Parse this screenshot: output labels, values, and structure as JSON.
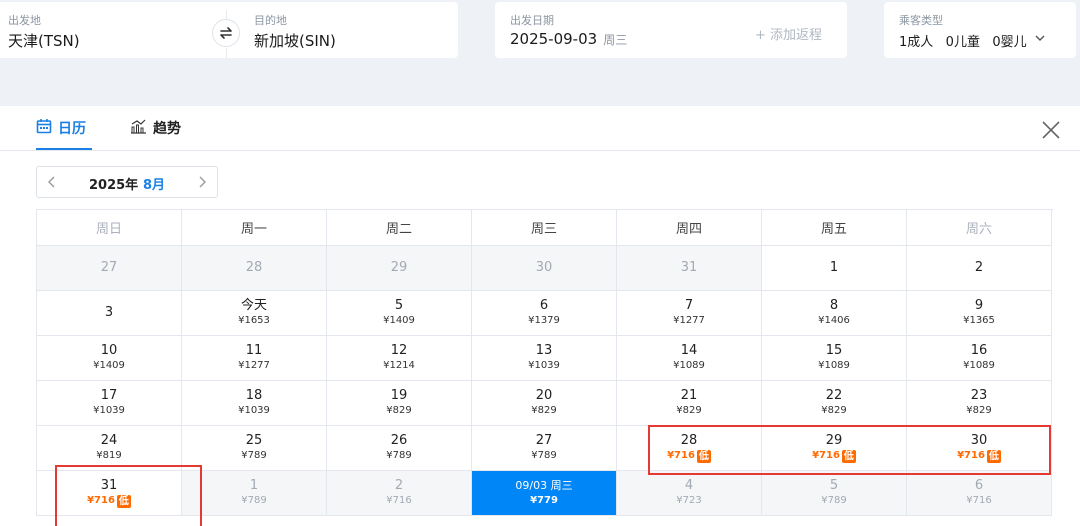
{
  "search": {
    "from_label": "出发地",
    "from_value": "天津(TSN)",
    "to_label": "目的地",
    "to_value": "新加坡(SIN)",
    "date_label": "出发日期",
    "date_value": "2025-09-03",
    "date_weekday": "周三",
    "add_return": "+ 添加返程",
    "pax_label": "乘客类型",
    "pax_value": "1成人   0儿童   0婴儿"
  },
  "tabs": [
    {
      "label": "日历",
      "icon": "calendar-icon",
      "active": true
    },
    {
      "label": "趋势",
      "icon": "trend-chart-icon",
      "active": false
    }
  ],
  "month_nav": {
    "year": "2025年",
    "month": "8月"
  },
  "weekdays": [
    "周日",
    "周一",
    "周二",
    "周三",
    "周四",
    "周五",
    "周六"
  ],
  "calendar": [
    [
      {
        "day": "27",
        "price": "",
        "dim": true
      },
      {
        "day": "28",
        "price": "",
        "dim": true
      },
      {
        "day": "29",
        "price": "",
        "dim": true
      },
      {
        "day": "30",
        "price": "",
        "dim": true
      },
      {
        "day": "31",
        "price": "",
        "dim": true
      },
      {
        "day": "1",
        "price": ""
      },
      {
        "day": "2",
        "price": ""
      }
    ],
    [
      {
        "day": "3",
        "price": ""
      },
      {
        "day": "今天",
        "price": "¥1653"
      },
      {
        "day": "5",
        "price": "¥1409"
      },
      {
        "day": "6",
        "price": "¥1379"
      },
      {
        "day": "7",
        "price": "¥1277"
      },
      {
        "day": "8",
        "price": "¥1406"
      },
      {
        "day": "9",
        "price": "¥1365"
      }
    ],
    [
      {
        "day": "10",
        "price": "¥1409"
      },
      {
        "day": "11",
        "price": "¥1277"
      },
      {
        "day": "12",
        "price": "¥1214"
      },
      {
        "day": "13",
        "price": "¥1039"
      },
      {
        "day": "14",
        "price": "¥1089"
      },
      {
        "day": "15",
        "price": "¥1089"
      },
      {
        "day": "16",
        "price": "¥1089"
      }
    ],
    [
      {
        "day": "17",
        "price": "¥1039"
      },
      {
        "day": "18",
        "price": "¥1039"
      },
      {
        "day": "19",
        "price": "¥829"
      },
      {
        "day": "20",
        "price": "¥829"
      },
      {
        "day": "21",
        "price": "¥829"
      },
      {
        "day": "22",
        "price": "¥829"
      },
      {
        "day": "23",
        "price": "¥829"
      }
    ],
    [
      {
        "day": "24",
        "price": "¥819"
      },
      {
        "day": "25",
        "price": "¥789"
      },
      {
        "day": "26",
        "price": "¥789"
      },
      {
        "day": "27",
        "price": "¥789"
      },
      {
        "day": "28",
        "price": "¥716",
        "low": true
      },
      {
        "day": "29",
        "price": "¥716",
        "low": true
      },
      {
        "day": "30",
        "price": "¥716",
        "low": true
      }
    ],
    [
      {
        "day": "31",
        "price": "¥716",
        "low": true
      },
      {
        "day": "1",
        "price": "¥789",
        "dim": true
      },
      {
        "day": "2",
        "price": "¥716",
        "dim": true
      },
      {
        "day": "09/03 周三",
        "price": "¥779",
        "selected": true
      },
      {
        "day": "4",
        "price": "¥723",
        "dim": true
      },
      {
        "day": "5",
        "price": "¥789",
        "dim": true
      },
      {
        "day": "6",
        "price": "¥716",
        "dim": true
      }
    ]
  ],
  "low_badge": "低",
  "colors": {
    "accent": "#0086f6",
    "low_price": "#ff6a00",
    "highlight_box": "#e53935"
  }
}
